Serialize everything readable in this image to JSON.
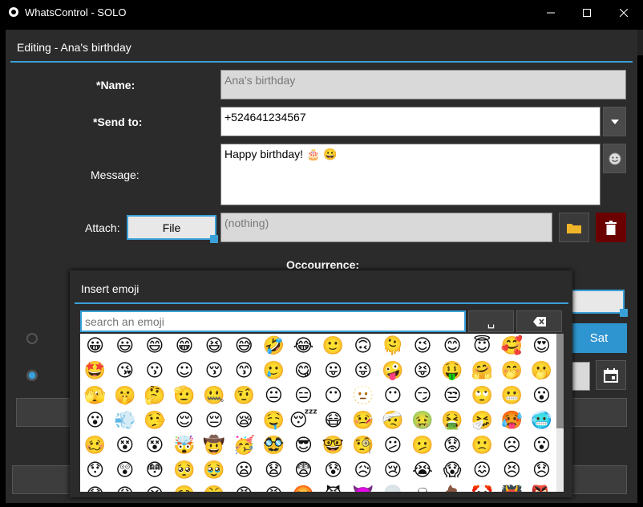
{
  "window": {
    "title": "WhatsControl - SOLO"
  },
  "dialog": {
    "title": "Editing - Ana's birthday"
  },
  "form": {
    "name_label": "*Name:",
    "name_value": "Ana's birthday",
    "sendto_label": "*Send to:",
    "sendto_value": "+524641234567",
    "message_label": "Message:",
    "message_value": "Happy birthday! 🎂 😀",
    "attach_label": "Attach:",
    "file_button": "File",
    "attach_value": "(nothing)",
    "occurrence_label": "Occourrence:",
    "day_button": "Sat"
  },
  "emoji_popup": {
    "title": "Insert emoji",
    "search_placeholder": "search an emoji",
    "space_key": "␣",
    "backspace_key": "⌫",
    "rows": [
      [
        "😀",
        "😃",
        "😄",
        "😁",
        "😆",
        "😅",
        "🤣",
        "😂",
        "🙂",
        "🙃",
        "🫠",
        "😉",
        "😊",
        "😇",
        "🥰",
        "😍"
      ],
      [
        "🤩",
        "😘",
        "😗",
        "☺",
        "😚",
        "😙",
        "🥲",
        "😋",
        "😛",
        "😜",
        "🤪",
        "😝",
        "🤑",
        "🤗",
        "🤭",
        "🫢"
      ],
      [
        "🫣",
        "🤫",
        "🤔",
        "🫡",
        "🤐",
        "🤨",
        "😐",
        "😑",
        "😶",
        "🫥",
        "😶",
        "😏",
        "😒",
        "🙄",
        "😬",
        "😮"
      ],
      [
        "😮",
        "💨",
        "🤥",
        "😌",
        "😔",
        "😪",
        "🤤",
        "😴",
        "😷",
        "🤒",
        "🤕",
        "🤢",
        "🤮",
        "🤧",
        "🥵",
        "🥶"
      ],
      [
        "🥴",
        "😵",
        "😵",
        "🤯",
        "🤠",
        "🥳",
        "🥸",
        "😎",
        "🤓",
        "🧐",
        "😕",
        "🫤",
        "😟",
        "🙁",
        "☹",
        "😮"
      ],
      [
        "😯",
        "😲",
        "😳",
        "🥺",
        "🥹",
        "😦",
        "😧",
        "😨",
        "😰",
        "😥",
        "😢",
        "😭",
        "😱",
        "😖",
        "😣",
        "😞"
      ],
      [
        "😓",
        "😩",
        "😫",
        "🥱",
        "😤",
        "😡",
        "😠",
        "🤬",
        "😈",
        "👿",
        "💀",
        "☠",
        "💩",
        "🤡",
        "👹",
        "👺"
      ]
    ]
  },
  "colors": {
    "accent": "#3aa0d8",
    "background": "#2b2b2b",
    "delete": "#6b0000",
    "folder": "#f0b429"
  },
  "icons": {
    "app": "whatsapp-icon",
    "minimize": "minimize-icon",
    "maximize": "maximize-icon",
    "close": "close-icon",
    "dropdown": "chevron-down-icon",
    "emoji": "emoji-icon",
    "folder": "folder-icon",
    "trash": "trash-icon",
    "calendar": "calendar-icon"
  }
}
